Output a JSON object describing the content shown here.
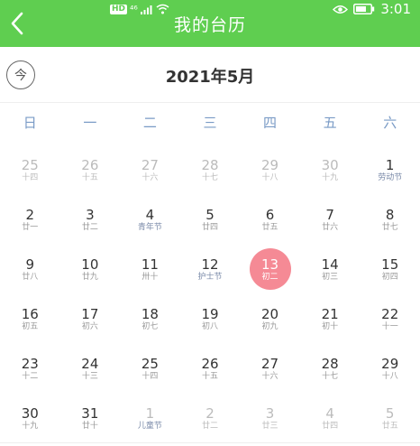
{
  "header": {
    "title": "我的台历",
    "time": "3:01",
    "hd": "HD",
    "network": "⁴⁶"
  },
  "month_bar": {
    "today_label": "今",
    "month_title": "2021年5月"
  },
  "weekdays": [
    "日",
    "一",
    "二",
    "三",
    "四",
    "五",
    "六"
  ],
  "weeks": [
    [
      {
        "num": "25",
        "lunar": "十四",
        "other": true
      },
      {
        "num": "26",
        "lunar": "十五",
        "other": true
      },
      {
        "num": "27",
        "lunar": "十六",
        "other": true
      },
      {
        "num": "28",
        "lunar": "十七",
        "other": true
      },
      {
        "num": "29",
        "lunar": "十八",
        "other": true
      },
      {
        "num": "30",
        "lunar": "十九",
        "other": true
      },
      {
        "num": "1",
        "lunar": "劳动节",
        "festival": true
      }
    ],
    [
      {
        "num": "2",
        "lunar": "廿一"
      },
      {
        "num": "3",
        "lunar": "廿二"
      },
      {
        "num": "4",
        "lunar": "青年节",
        "festival": true
      },
      {
        "num": "5",
        "lunar": "廿四"
      },
      {
        "num": "6",
        "lunar": "廿五"
      },
      {
        "num": "7",
        "lunar": "廿六"
      },
      {
        "num": "8",
        "lunar": "廿七"
      }
    ],
    [
      {
        "num": "9",
        "lunar": "廿八"
      },
      {
        "num": "10",
        "lunar": "廿九"
      },
      {
        "num": "11",
        "lunar": "卅十"
      },
      {
        "num": "12",
        "lunar": "护士节",
        "festival": true
      },
      {
        "num": "13",
        "lunar": "初二",
        "today": true
      },
      {
        "num": "14",
        "lunar": "初三"
      },
      {
        "num": "15",
        "lunar": "初四"
      }
    ],
    [
      {
        "num": "16",
        "lunar": "初五"
      },
      {
        "num": "17",
        "lunar": "初六"
      },
      {
        "num": "18",
        "lunar": "初七"
      },
      {
        "num": "19",
        "lunar": "初八"
      },
      {
        "num": "20",
        "lunar": "初九"
      },
      {
        "num": "21",
        "lunar": "初十"
      },
      {
        "num": "22",
        "lunar": "十一"
      }
    ],
    [
      {
        "num": "23",
        "lunar": "十二"
      },
      {
        "num": "24",
        "lunar": "十三"
      },
      {
        "num": "25",
        "lunar": "十四"
      },
      {
        "num": "26",
        "lunar": "十五"
      },
      {
        "num": "27",
        "lunar": "十六"
      },
      {
        "num": "28",
        "lunar": "十七"
      },
      {
        "num": "29",
        "lunar": "十八"
      }
    ],
    [
      {
        "num": "30",
        "lunar": "十九"
      },
      {
        "num": "31",
        "lunar": "廿十"
      },
      {
        "num": "1",
        "lunar": "儿童节",
        "other": true,
        "festival": true
      },
      {
        "num": "2",
        "lunar": "廿二",
        "other": true
      },
      {
        "num": "3",
        "lunar": "廿三",
        "other": true
      },
      {
        "num": "4",
        "lunar": "廿四",
        "other": true
      },
      {
        "num": "5",
        "lunar": "廿五",
        "other": true
      }
    ]
  ],
  "colors": {
    "header_green": "#5fce50",
    "today_pink": "#f58a95",
    "weekday_blue": "#7a9bc6"
  }
}
